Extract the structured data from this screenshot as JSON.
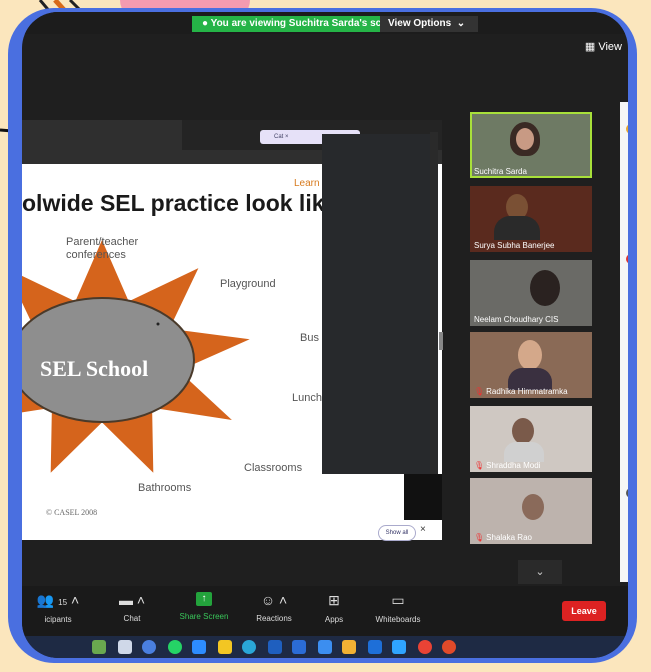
{
  "banner": {
    "viewing_text": "You are viewing Suchitra Sarda's screen",
    "view_options": "View Options",
    "view_button": "View"
  },
  "slide": {
    "browser_tab": "Cat",
    "learn_label": "Learn",
    "title": "olwide SEL practice look like",
    "center_text": "SEL School",
    "labels": {
      "parent_teacher": "Parent/teacher conferences",
      "playground": "Playground",
      "bus": "Bus",
      "lunch": "Lunch",
      "classrooms": "Classrooms",
      "bathrooms": "Bathrooms"
    },
    "copyright": "© CASEL 2008",
    "show_all": "Show all",
    "close": "×",
    "colors": {
      "sun": "#d5641c",
      "oval": "#8e8e8e",
      "oval_border": "#4a3a2a"
    }
  },
  "participants": [
    {
      "name": "Suchitra Sarda",
      "muted": false,
      "active": true
    },
    {
      "name": "Surya Subha Banerjee",
      "muted": false,
      "active": false
    },
    {
      "name": "Neelam Choudhary CIS",
      "muted": false,
      "active": false
    },
    {
      "name": "Radhika Himmatramka",
      "muted": true,
      "active": false
    },
    {
      "name": "Shraddha Modi",
      "muted": true,
      "active": false
    },
    {
      "name": "Shalaka Rao",
      "muted": true,
      "active": false
    }
  ],
  "toolbar": {
    "participants_label": "icipants",
    "participants_count": "15",
    "chat_label": "Chat",
    "share_label": "Share Screen",
    "reactions_label": "Reactions",
    "apps_label": "Apps",
    "whiteboards_label": "Whiteboards",
    "leave_label": "Leave"
  },
  "colors": {
    "frame": "#4a6fe0",
    "background": "#fbe6bd",
    "share_green": "#23a33c",
    "leave_red": "#dd2222"
  }
}
